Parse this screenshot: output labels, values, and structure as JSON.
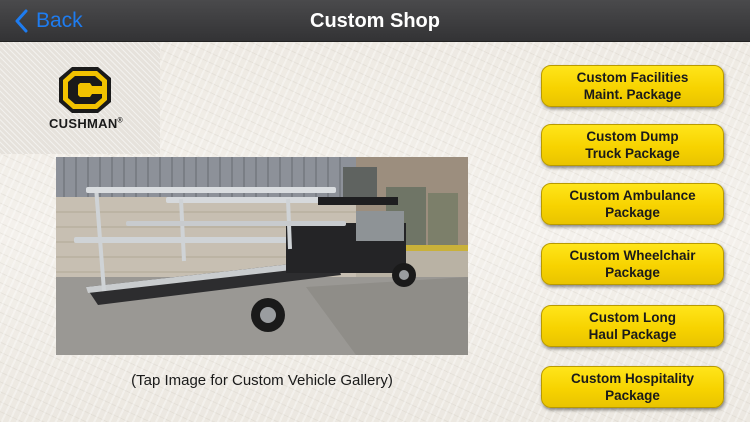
{
  "navbar": {
    "back_label": "Back",
    "title": "Custom Shop",
    "back_icon": "chevron-left-icon",
    "accent_color": "#1e7cf0"
  },
  "brand": {
    "logo_text": "CUSHMAN",
    "trademark": "®",
    "logo_color": "#f2c300"
  },
  "gallery": {
    "caption": "(Tap Image for Custom Vehicle Gallery)"
  },
  "packages": [
    {
      "label": "Custom Facilities\nMaint. Package"
    },
    {
      "label": "Custom Dump\nTruck Package"
    },
    {
      "label": "Custom Ambulance\nPackage"
    },
    {
      "label": "Custom Wheelchair\nPackage"
    },
    {
      "label": "Custom Long\nHaul Package"
    },
    {
      "label": "Custom Hospitality\nPackage"
    }
  ],
  "button_color": "#f7d300"
}
